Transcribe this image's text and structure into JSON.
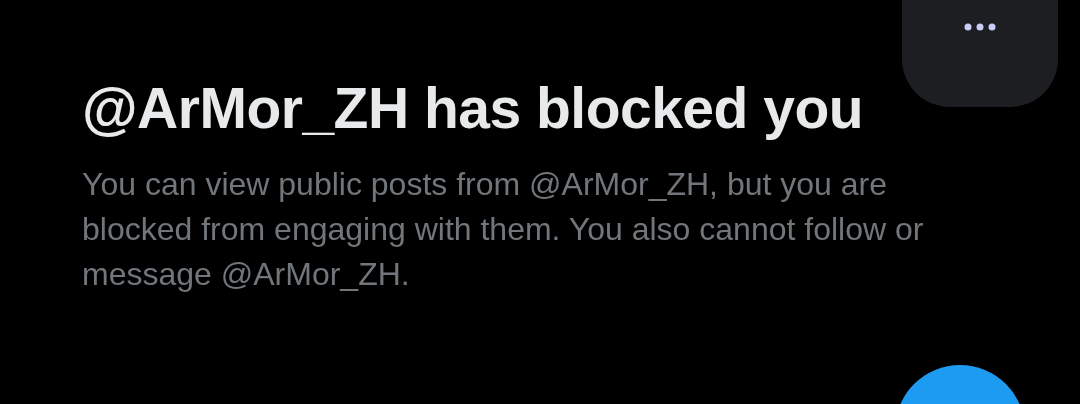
{
  "title": "@ArMor_ZH has blocked you",
  "message": "You can view public posts from @ArMor_ZH, but you are blocked from engaging with them. You also cannot follow or message @ArMor_ZH."
}
